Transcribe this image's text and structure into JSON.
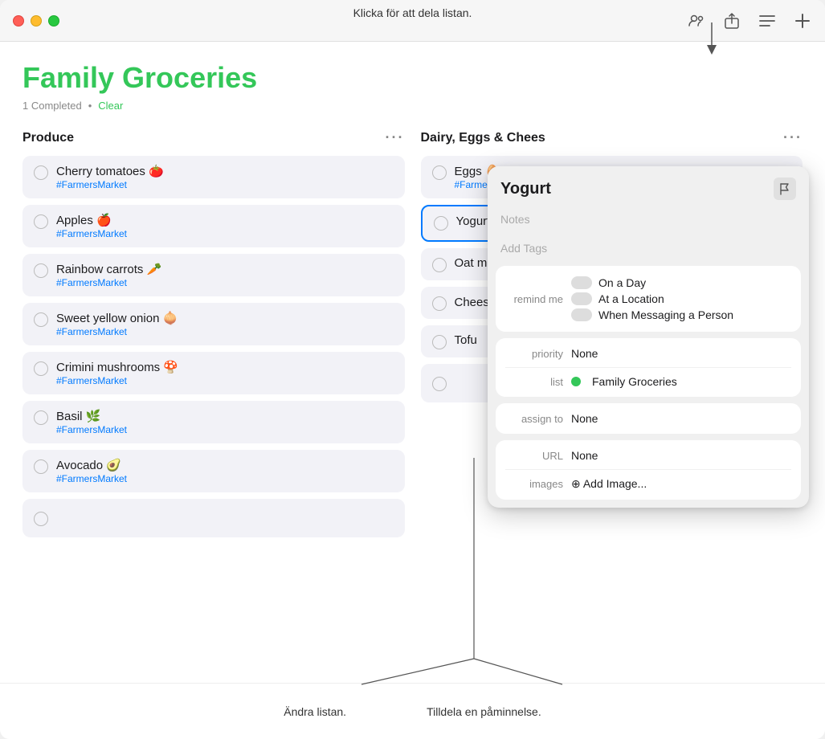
{
  "annotations": {
    "top": "Klicka för att dela listan.",
    "bottom_left": "Ändra listan.",
    "bottom_right": "Tilldela en påminnelse."
  },
  "titlebar": {
    "toolbar_icons": [
      "share-people-icon",
      "share-icon",
      "list-icon",
      "add-icon"
    ]
  },
  "main": {
    "title": "Family Groceries",
    "completed_text": "1 Completed",
    "separator": "•",
    "clear_label": "Clear"
  },
  "columns": [
    {
      "id": "produce",
      "header": "Produce",
      "items": [
        {
          "name": "Cherry tomatoes 🍅",
          "tag": "#FarmersMarket",
          "checked": false
        },
        {
          "name": "Apples 🍎",
          "tag": "#FarmersMarket",
          "checked": false
        },
        {
          "name": "Rainbow carrots 🥕",
          "tag": "#FarmersMarket",
          "checked": false
        },
        {
          "name": "Sweet yellow onion 🧅",
          "tag": "#FarmersMarket",
          "checked": false
        },
        {
          "name": "Crimini mushrooms 🍄",
          "tag": "#FarmersMarket",
          "checked": false
        },
        {
          "name": "Basil 🌿",
          "tag": "#FarmersMarket",
          "checked": false
        },
        {
          "name": "Avocado 🥑",
          "tag": "#FarmersMarket",
          "checked": false
        }
      ]
    },
    {
      "id": "dairy",
      "header": "Dairy, Eggs & Chees",
      "items": [
        {
          "name": "Eggs 🥚",
          "tag": "#FarmersMarket",
          "checked": false
        },
        {
          "name": "Yogurt",
          "tag": "",
          "checked": false,
          "selected": true
        },
        {
          "name": "Oat milk",
          "tag": "",
          "checked": false
        },
        {
          "name": "Cheese 🧀",
          "tag": "",
          "checked": false
        },
        {
          "name": "Tofu",
          "tag": "",
          "checked": false
        }
      ]
    }
  ],
  "detail_panel": {
    "title": "Yogurt",
    "notes_placeholder": "Notes",
    "tags_placeholder": "Add Tags",
    "remind_me_label": "remind me",
    "remind_options": [
      {
        "label": "On a Day"
      },
      {
        "label": "At a Location"
      },
      {
        "label": "When Messaging a Person"
      }
    ],
    "priority_label": "priority",
    "priority_value": "None",
    "list_label": "list",
    "list_value": "Family Groceries",
    "assign_label": "assign to",
    "assign_value": "None",
    "url_label": "URL",
    "url_value": "None",
    "images_label": "images",
    "add_image_label": "⊕ Add Image..."
  }
}
